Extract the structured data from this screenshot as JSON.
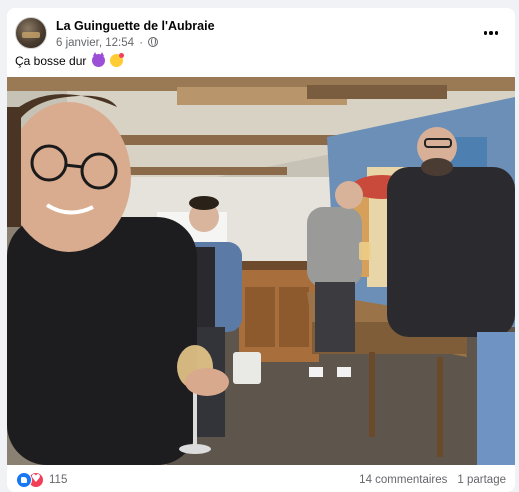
{
  "post": {
    "page_name": "La Guinguette de l'Aubraie",
    "date": "6 janvier, 12:54",
    "separator": "·",
    "privacy_icon": "globe-icon",
    "text": "Ça bosse dur",
    "emojis": [
      "smiling-devil-emoji",
      "smiling-face-with-hearts-emoji"
    ],
    "menu_icon": "more-options-icon"
  },
  "reactions": {
    "types": [
      "like",
      "love"
    ],
    "count": "115",
    "comments": "14 commentaires",
    "shares": "1 partage"
  },
  "colors": {
    "background": "#f0f2f5",
    "card": "#ffffff",
    "secondary_text": "#65676b",
    "like_blue": "#1877f2",
    "love_red": "#f33e58"
  }
}
